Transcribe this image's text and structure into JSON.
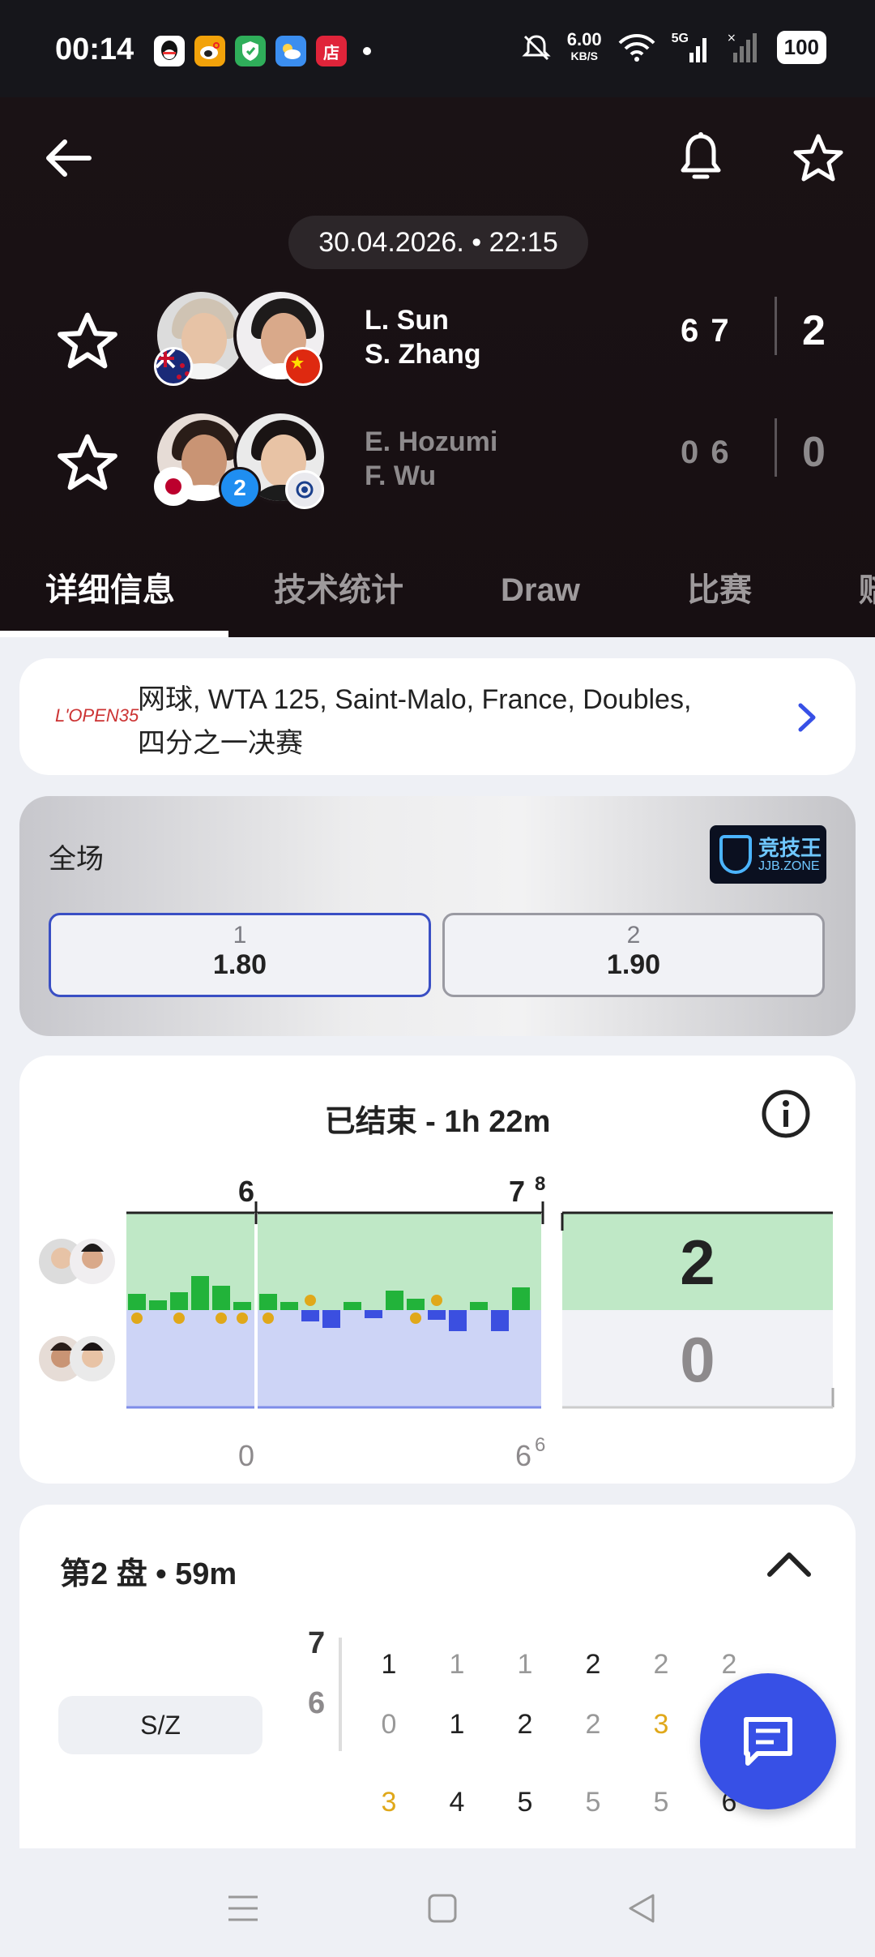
{
  "status_bar": {
    "time": "00:14",
    "apps": [
      "qq-icon",
      "weibo-icon",
      "shield-app-icon",
      "weather-app-icon",
      "store-app-icon"
    ],
    "store_label": "店",
    "net_speed": "6.00",
    "net_unit": "KB/S",
    "signal_label": "5G",
    "battery": "100"
  },
  "match": {
    "datetime": "30.04.2026. • 22:15",
    "team1": {
      "player1": "L. Sun",
      "player2": "S. Zhang",
      "sets": "6 7",
      "total": "2"
    },
    "team2": {
      "player1": "E. Hozumi",
      "player2": "F. Wu",
      "seed": "2",
      "sets": "0 6",
      "total": "0"
    }
  },
  "tabs": [
    "详细信息",
    "技术统计",
    "Draw",
    "比赛",
    "赔"
  ],
  "tournament": {
    "logo_text": "L'OPEN35",
    "line1": "网球, WTA 125, Saint-Malo, France, Doubles,",
    "line2": "四分之一决赛"
  },
  "odds": {
    "title": "全场",
    "bookmaker_cn": "竞技王",
    "bookmaker_en": "JJB.ZONE",
    "home_label": "1",
    "home_value": "1.80",
    "away_label": "2",
    "away_value": "1.90"
  },
  "momentum": {
    "title": "已结束 - 1h 22m",
    "set1_top": "6",
    "set2_top": "7",
    "set2_top_tb": "8",
    "set1_bottom": "0",
    "set2_bottom": "6",
    "set2_bottom_tb": "6",
    "total_top": "2",
    "total_bottom": "0"
  },
  "set_detail": {
    "title": "第2 盘 • 59m",
    "pair_label": "S/Z",
    "score_top": "7",
    "score_bottom": "6",
    "row1": [
      "1",
      "1",
      "1",
      "2",
      "2",
      "2"
    ],
    "row2": [
      "0",
      "1",
      "2",
      "2",
      "3"
    ],
    "row3": [
      "3",
      "4",
      "5",
      "5",
      "5",
      "6"
    ]
  },
  "colors": {
    "accent": "#3750e6",
    "team1_momentum": "#22b33a",
    "team2_momentum": "#3b4fe0",
    "break_marker": "#e0a81a"
  }
}
